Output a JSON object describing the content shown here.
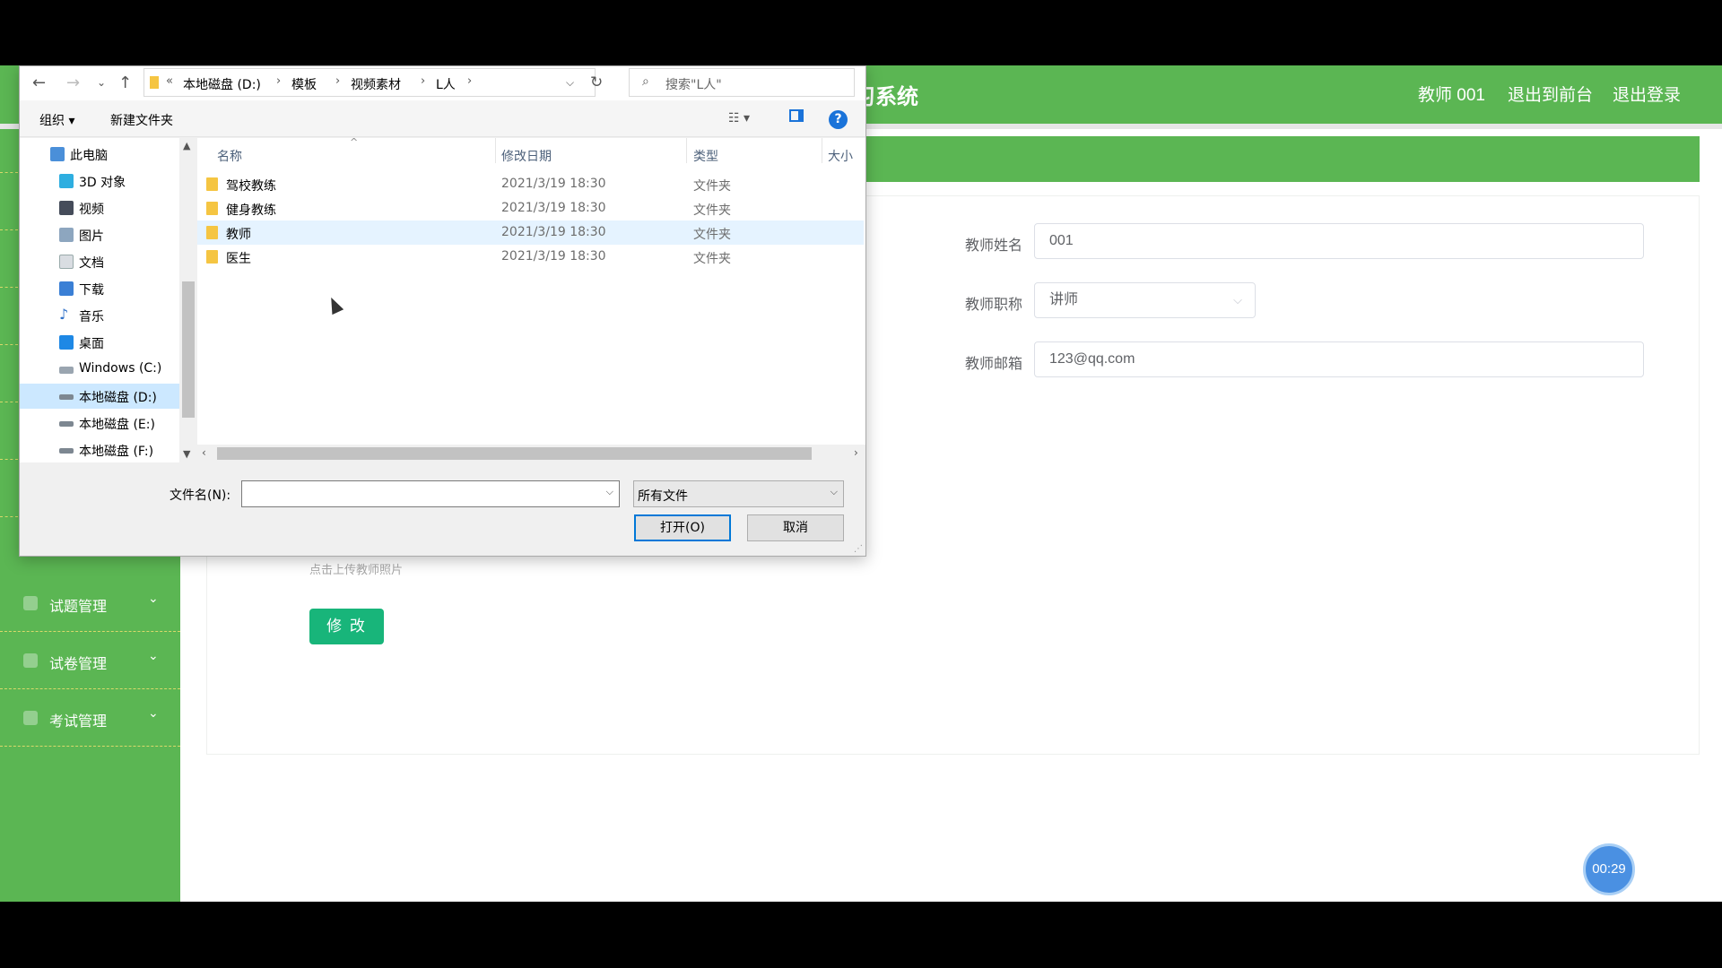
{
  "app": {
    "title_partial": "习系统",
    "nav": {
      "user": "教师 001",
      "front": "退出到前台",
      "logout": "退出登录"
    }
  },
  "sidebar": {
    "items": [
      {
        "label": "试题管理",
        "icon": "list-icon"
      },
      {
        "label": "试卷管理",
        "icon": "paper-icon"
      },
      {
        "label": "考试管理",
        "icon": "exam-icon"
      }
    ]
  },
  "form": {
    "name_label": "教师姓名",
    "name_value": "001",
    "title_label": "教师职称",
    "title_value": "讲师",
    "email_label": "教师邮箱",
    "email_value": "123@qq.com",
    "photo_hint": "点击上传教师照片",
    "submit_label": "修 改"
  },
  "timer": "00:29",
  "dialog": {
    "path": {
      "overflow": "«",
      "crumbs": [
        "本地磁盘 (D:)",
        "模板",
        "视频素材",
        "L人"
      ]
    },
    "search_placeholder": "搜索\"L人\"",
    "toolbar": {
      "organize": "组织",
      "new_folder": "新建文件夹"
    },
    "tree": [
      {
        "label": "此电脑",
        "icon": "computer-icon"
      },
      {
        "label": "3D 对象",
        "icon": "3d-objects-icon"
      },
      {
        "label": "视频",
        "icon": "video-icon"
      },
      {
        "label": "图片",
        "icon": "pictures-icon"
      },
      {
        "label": "文档",
        "icon": "documents-icon"
      },
      {
        "label": "下载",
        "icon": "download-icon"
      },
      {
        "label": "音乐",
        "icon": "music-icon"
      },
      {
        "label": "桌面",
        "icon": "desktop-icon"
      },
      {
        "label": "Windows (C:)",
        "icon": "drive-icon"
      },
      {
        "label": "本地磁盘 (D:)",
        "icon": "drive-icon",
        "selected": true
      },
      {
        "label": "本地磁盘 (E:)",
        "icon": "drive-icon"
      },
      {
        "label": "本地磁盘 (F:)",
        "icon": "drive-icon"
      }
    ],
    "columns": {
      "name": "名称",
      "date": "修改日期",
      "type": "类型",
      "size": "大小"
    },
    "files": [
      {
        "name": "驾校教练",
        "date": "2021/3/19 18:30",
        "type": "文件夹"
      },
      {
        "name": "健身教练",
        "date": "2021/3/19 18:30",
        "type": "文件夹"
      },
      {
        "name": "教师",
        "date": "2021/3/19 18:30",
        "type": "文件夹",
        "hover": true
      },
      {
        "name": "医生",
        "date": "2021/3/19 18:30",
        "type": "文件夹"
      }
    ],
    "filename_label": "文件名(N):",
    "filename_value": "",
    "filetype": "所有文件",
    "open_label": "打开(O)",
    "cancel_label": "取消"
  },
  "colors": {
    "brand_green": "#5bb653",
    "button_green": "#18b57a",
    "timer_blue": "#4a90e2"
  }
}
